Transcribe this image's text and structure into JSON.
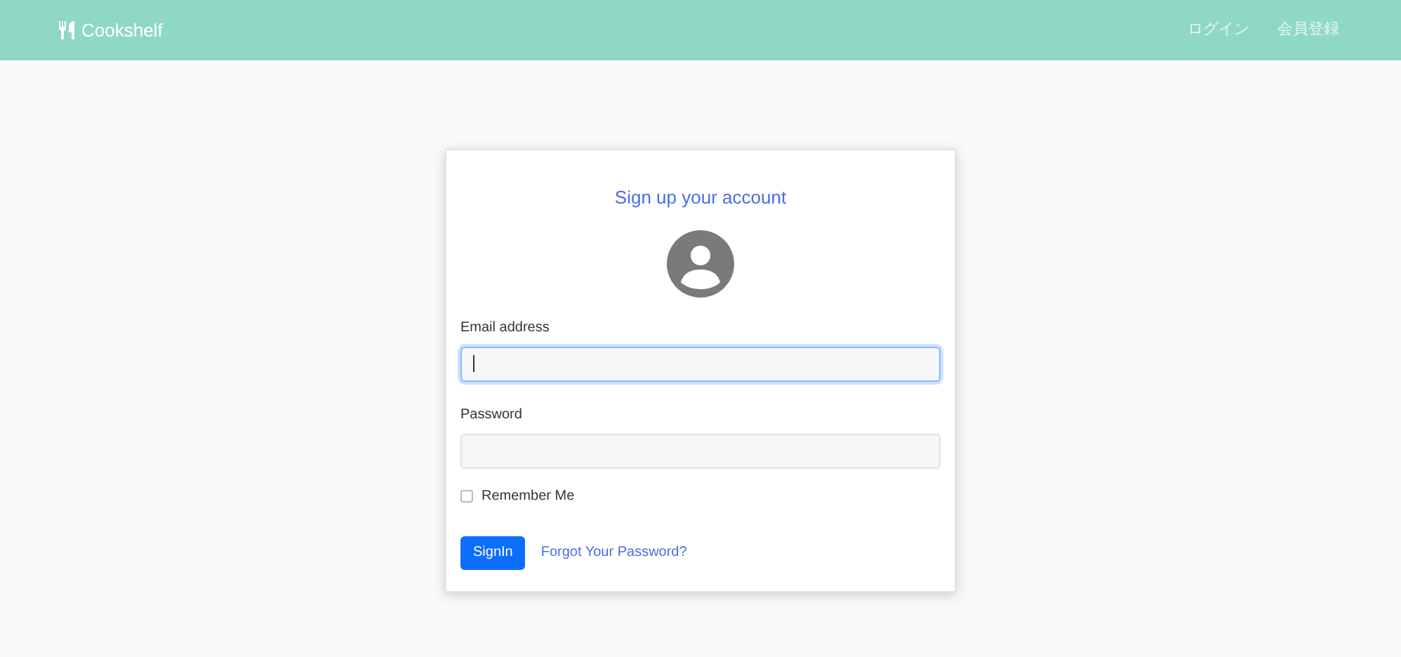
{
  "navbar": {
    "brand": "Cookshelf",
    "links": [
      "ログイン",
      "会員登録"
    ]
  },
  "card": {
    "title": "Sign up your account",
    "fields": [
      {
        "label": "Email address",
        "focused": true
      },
      {
        "label": "Password",
        "focused": false
      }
    ],
    "remember": {
      "label": "Remember Me",
      "checked": false
    },
    "submit": "SignIn",
    "forgot_link": "Forgot Your Password?"
  }
}
